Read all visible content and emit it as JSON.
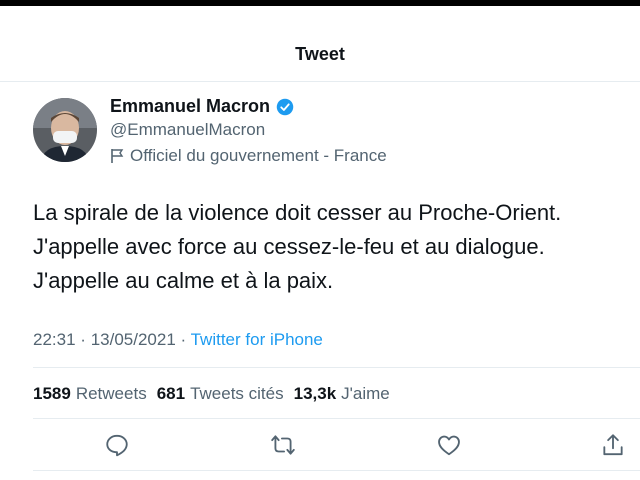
{
  "header": {
    "title": "Tweet"
  },
  "author": {
    "name": "Emmanuel Macron",
    "handle": "@EmmanuelMacron",
    "label": "Officiel du gouvernement - France"
  },
  "tweet": {
    "lines": [
      "La spirale de la violence doit cesser au Proche-Orient.",
      "J'appelle avec force au cessez-le-feu et au dialogue.",
      "J'appelle au calme et à la paix."
    ],
    "time": "22:31",
    "date": "13/05/2021",
    "separator": "·",
    "source": "Twitter for iPhone"
  },
  "stats": {
    "retweets_count": "1589",
    "retweets_label": "Retweets",
    "quotes_count": "681",
    "quotes_label": "Tweets cités",
    "likes_count": "13,3k",
    "likes_label": "J'aime"
  },
  "icons": {
    "verified": "verified-badge-icon",
    "label": "flag-icon",
    "reply": "reply-icon",
    "retweet": "retweet-icon",
    "like": "heart-icon",
    "share": "share-icon"
  },
  "colors": {
    "accent": "#1d9bf0",
    "text": "#0f1419",
    "secondary": "#536471"
  }
}
